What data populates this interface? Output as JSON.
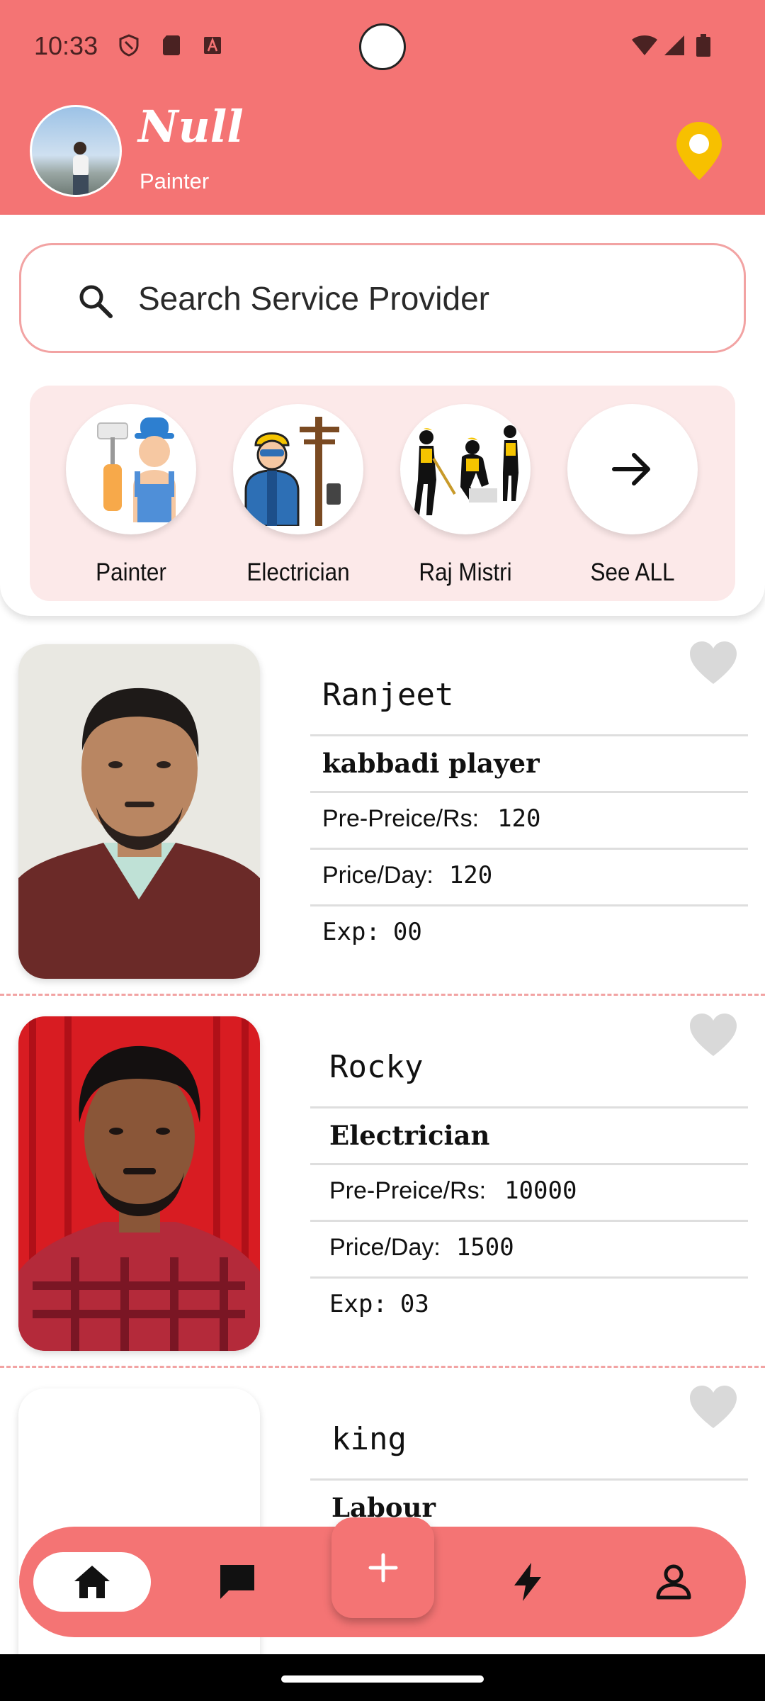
{
  "status_bar": {
    "time": "10:33"
  },
  "profile": {
    "name": "Null",
    "role": "Painter"
  },
  "search": {
    "placeholder": "Search Service Provider"
  },
  "categories": [
    {
      "label": "Painter",
      "icon": "painter-icon"
    },
    {
      "label": "Electrician",
      "icon": "electrician-icon"
    },
    {
      "label": "Raj Mistri",
      "icon": "construction-workers-icon"
    },
    {
      "label": "See ALL",
      "icon": "arrow-right-icon"
    }
  ],
  "providers": [
    {
      "name": "Ranjeet",
      "title": "kabbadi player",
      "pre_price_label": "Pre-Preice/Rs:",
      "pre_price": "120",
      "price_day_label": "Price/Day:",
      "price_day": "120",
      "exp_label": "Exp:",
      "exp": "00"
    },
    {
      "name": "Rocky",
      "title": "Electrician",
      "pre_price_label": "Pre-Preice/Rs:",
      "pre_price": "10000",
      "price_day_label": "Price/Day:",
      "price_day": "1500",
      "exp_label": "Exp:",
      "exp": "03"
    },
    {
      "name": "king",
      "title": "Labour"
    }
  ],
  "nav": {
    "items": [
      "home-icon",
      "chat-icon",
      "add-icon",
      "flash-icon",
      "profile-icon"
    ],
    "active": "home-icon"
  },
  "colors": {
    "primary": "#f47474",
    "panel": "#fce9e9",
    "search_border": "#f2a3a3",
    "pin": "#f7c000"
  }
}
